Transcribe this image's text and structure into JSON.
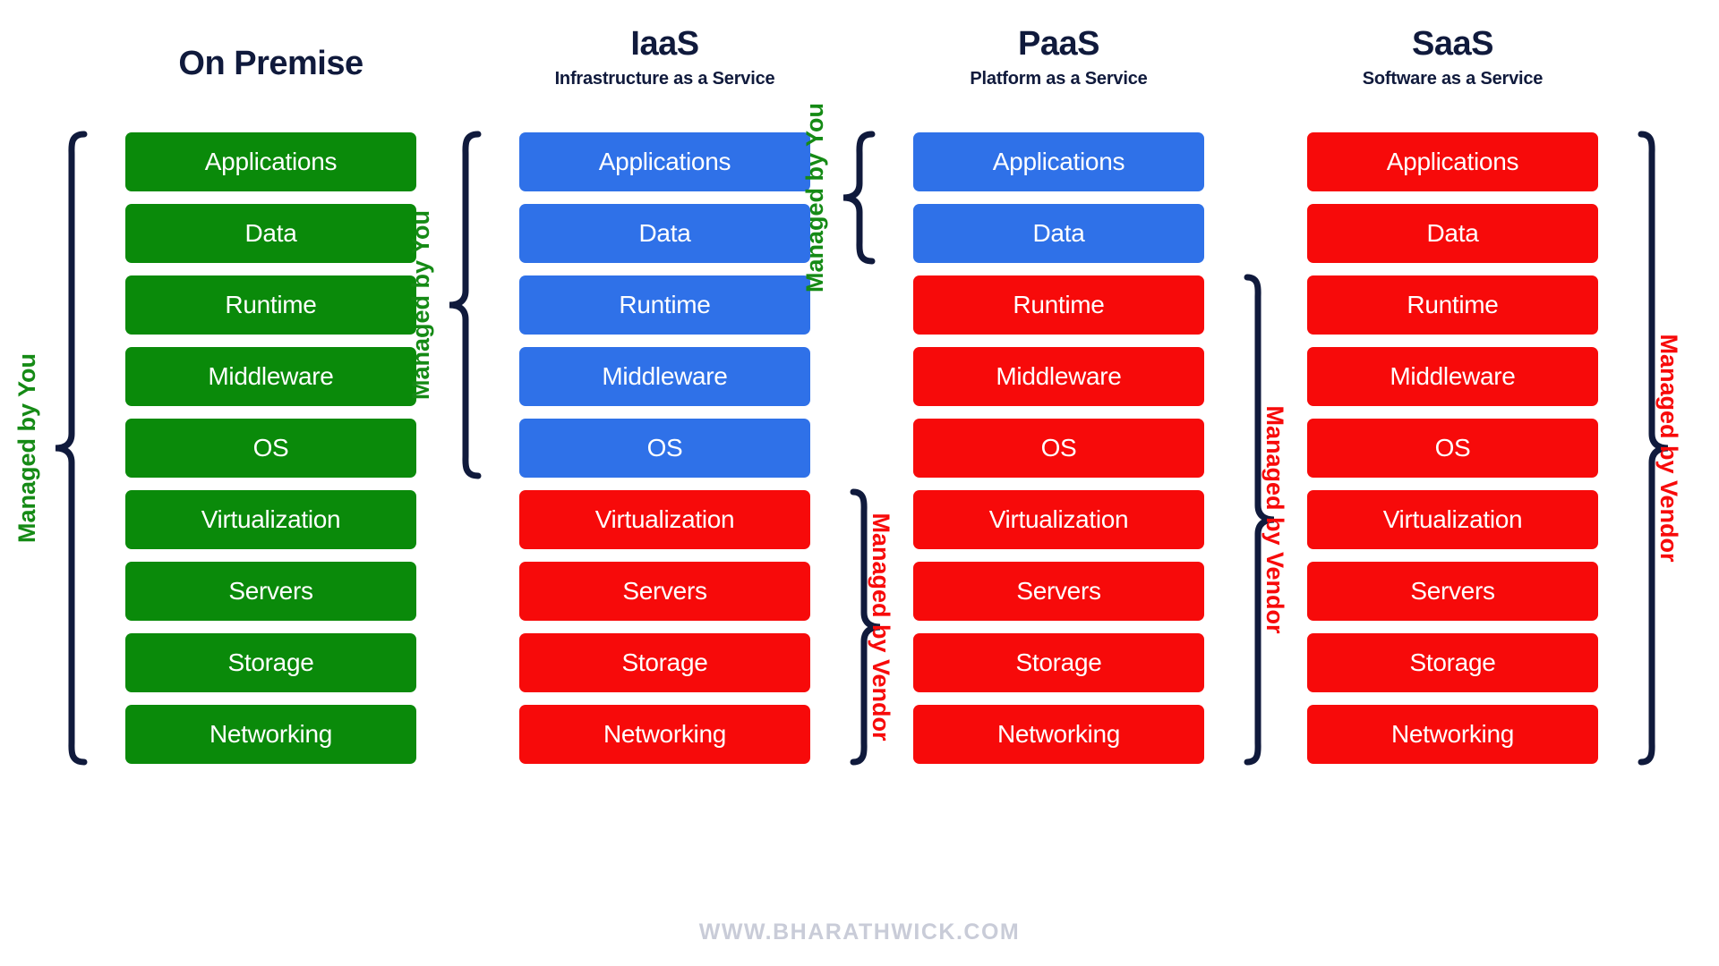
{
  "diagram": {
    "layer_names": [
      "Applications",
      "Data",
      "Runtime",
      "Middleware",
      "OS",
      "Virtualization",
      "Servers",
      "Storage",
      "Networking"
    ],
    "managed_by_you_label": "Managed by You",
    "managed_by_vendor_label": "Managed by Vendor"
  },
  "colors": {
    "green": "#0a8a0a",
    "blue": "#2f71e8",
    "red": "#f70a0a",
    "title_navy": "#101a3c",
    "you_green": "#158a15",
    "vendor_red": "#f70a0a",
    "watermark_gray": "#c9ccd8",
    "background": "#ffffff"
  },
  "columns": [
    {
      "title": "On Premise",
      "subtitle": "",
      "layers": [
        {
          "name": "Applications",
          "color": "green"
        },
        {
          "name": "Data",
          "color": "green"
        },
        {
          "name": "Runtime",
          "color": "green"
        },
        {
          "name": "Middleware",
          "color": "green"
        },
        {
          "name": "OS",
          "color": "green"
        },
        {
          "name": "Virtualization",
          "color": "green"
        },
        {
          "name": "Servers",
          "color": "green"
        },
        {
          "name": "Storage",
          "color": "green"
        },
        {
          "name": "Networking",
          "color": "green"
        }
      ],
      "braces": [
        {
          "label": "Managed by You",
          "owner": "you",
          "from_layer": 0,
          "to_layer": 8
        }
      ]
    },
    {
      "title": "IaaS",
      "subtitle": "Infrastructure as a Service",
      "layers": [
        {
          "name": "Applications",
          "color": "blue"
        },
        {
          "name": "Data",
          "color": "blue"
        },
        {
          "name": "Runtime",
          "color": "blue"
        },
        {
          "name": "Middleware",
          "color": "blue"
        },
        {
          "name": "OS",
          "color": "blue"
        },
        {
          "name": "Virtualization",
          "color": "red"
        },
        {
          "name": "Servers",
          "color": "red"
        },
        {
          "name": "Storage",
          "color": "red"
        },
        {
          "name": "Networking",
          "color": "red"
        }
      ],
      "braces": [
        {
          "label": "Managed by You",
          "owner": "you",
          "from_layer": 0,
          "to_layer": 4
        },
        {
          "label": "Managed by Vendor",
          "owner": "vendor",
          "from_layer": 5,
          "to_layer": 8
        }
      ]
    },
    {
      "title": "PaaS",
      "subtitle": "Platform as a Service",
      "layers": [
        {
          "name": "Applications",
          "color": "blue"
        },
        {
          "name": "Data",
          "color": "blue"
        },
        {
          "name": "Runtime",
          "color": "red"
        },
        {
          "name": "Middleware",
          "color": "red"
        },
        {
          "name": "OS",
          "color": "red"
        },
        {
          "name": "Virtualization",
          "color": "red"
        },
        {
          "name": "Servers",
          "color": "red"
        },
        {
          "name": "Storage",
          "color": "red"
        },
        {
          "name": "Networking",
          "color": "red"
        }
      ],
      "braces": [
        {
          "label": "Managed by You",
          "owner": "you",
          "from_layer": 0,
          "to_layer": 1
        },
        {
          "label": "Managed by Vendor",
          "owner": "vendor",
          "from_layer": 2,
          "to_layer": 8
        }
      ]
    },
    {
      "title": "SaaS",
      "subtitle": "Software as a Service",
      "layers": [
        {
          "name": "Applications",
          "color": "red"
        },
        {
          "name": "Data",
          "color": "red"
        },
        {
          "name": "Runtime",
          "color": "red"
        },
        {
          "name": "Middleware",
          "color": "red"
        },
        {
          "name": "OS",
          "color": "red"
        },
        {
          "name": "Virtualization",
          "color": "red"
        },
        {
          "name": "Servers",
          "color": "red"
        },
        {
          "name": "Storage",
          "color": "red"
        },
        {
          "name": "Networking",
          "color": "red"
        }
      ],
      "braces": [
        {
          "label": "Managed by Vendor",
          "owner": "vendor",
          "from_layer": 0,
          "to_layer": 8
        }
      ]
    }
  ],
  "watermark": {
    "text": "WWW.BHARATHWICK.COM"
  }
}
